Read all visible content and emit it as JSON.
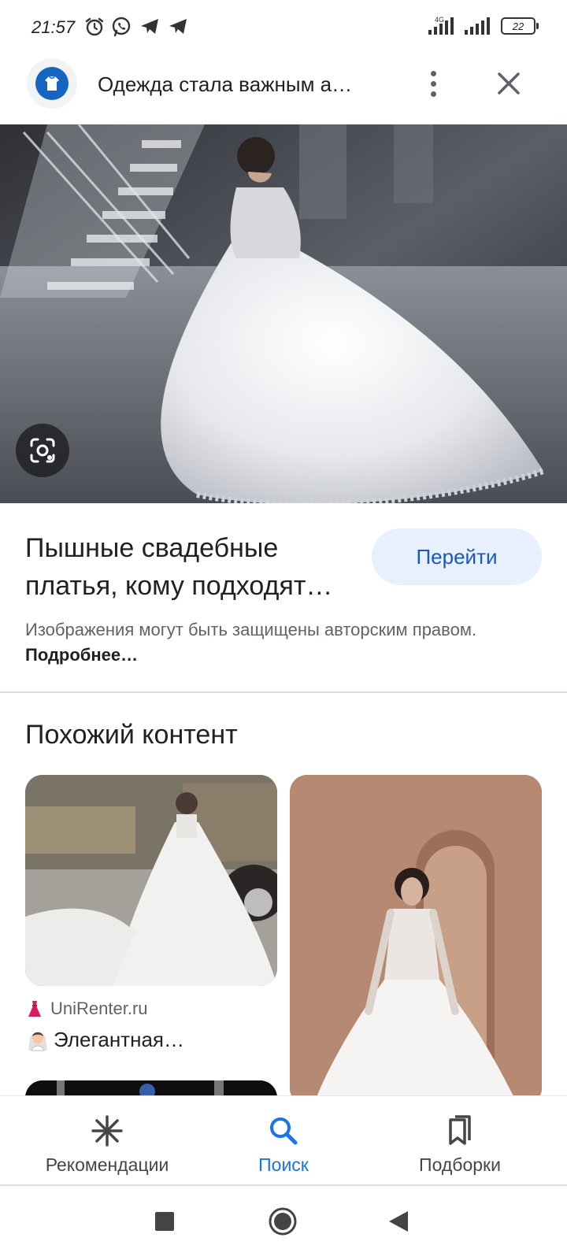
{
  "status_bar": {
    "time": "21:57",
    "network": "4G",
    "battery": "22"
  },
  "header": {
    "title": "Одежда стала важным а…"
  },
  "result": {
    "title": "Пышные свадебные платья, кому подходят…",
    "visit_label": "Перейти",
    "copyright_text": "Изображения могут быть защищены авторским правом.",
    "more_link": "Подробнее…"
  },
  "similar": {
    "heading": "Похожий контент",
    "cards": [
      {
        "source": "UniRenter.ru",
        "caption": "Элегантная…"
      }
    ]
  },
  "bottom_nav": {
    "items": [
      {
        "label": "Рекомендации",
        "icon": "asterisk-icon",
        "active": false
      },
      {
        "label": "Поиск",
        "icon": "search-icon",
        "active": true
      },
      {
        "label": "Подборки",
        "icon": "collections-icon",
        "active": false
      }
    ]
  },
  "colors": {
    "accent": "#1a73e8",
    "visit_bg": "#e8f0fe"
  }
}
